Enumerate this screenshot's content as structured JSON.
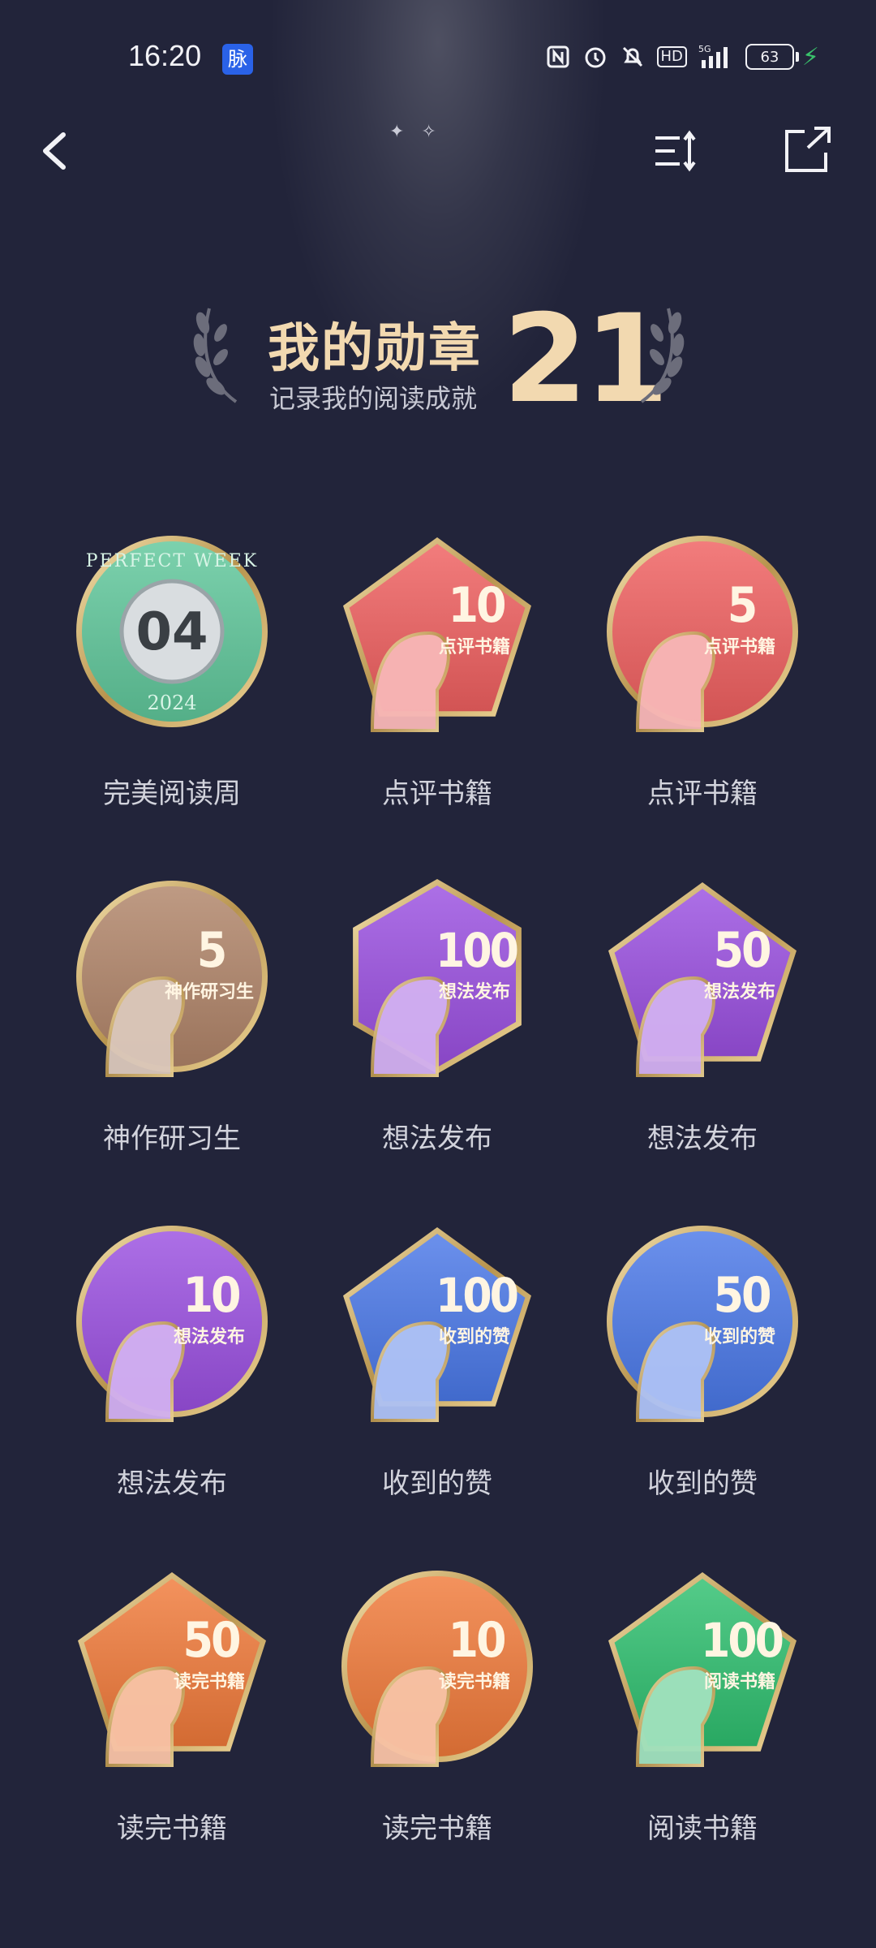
{
  "status_bar": {
    "time": "16:20",
    "app_badge": "脉",
    "network": "5G",
    "hd_label": "HD",
    "battery": "63"
  },
  "hero": {
    "title": "我的勋章",
    "subtitle": "记录我的阅读成就",
    "count": "21"
  },
  "badges": [
    {
      "label": "完美阅读周",
      "shape": "circle",
      "color": "#5fc79b",
      "line1": "04",
      "line2": "",
      "ring_text": "PERFECT WEEK",
      "year": "2024",
      "icon": "perfect-week-medal-icon"
    },
    {
      "label": "点评书籍",
      "shape": "pentagon",
      "color": "#ef5f5f",
      "line1": "10",
      "line2": "点评书籍",
      "icon": "apple-heart-icon"
    },
    {
      "label": "点评书籍",
      "shape": "circle",
      "color": "#ef5f5f",
      "line1": "5",
      "line2": "点评书籍",
      "icon": "apple-heart-icon"
    },
    {
      "label": "神作研习生",
      "shape": "circle",
      "color": "#b08468",
      "line1": "5",
      "line2": "神作研习生",
      "icon": "crown-icon"
    },
    {
      "label": "想法发布",
      "shape": "hexagon",
      "color": "#9a4fe0",
      "line1": "100",
      "line2": "想法发布",
      "icon": "head-profile-icon"
    },
    {
      "label": "想法发布",
      "shape": "pentagon",
      "color": "#9a4fe0",
      "line1": "50",
      "line2": "想法发布",
      "icon": "head-profile-icon"
    },
    {
      "label": "想法发布",
      "shape": "circle",
      "color": "#9a4fe0",
      "line1": "10",
      "line2": "想法发布",
      "icon": "head-profile-icon"
    },
    {
      "label": "收到的赞",
      "shape": "pentagon",
      "color": "#4a78e8",
      "line1": "100",
      "line2": "收到的赞",
      "icon": "thumbs-up-icon"
    },
    {
      "label": "收到的赞",
      "shape": "circle",
      "color": "#4a78e8",
      "line1": "50",
      "line2": "收到的赞",
      "icon": "thumbs-up-icon"
    },
    {
      "label": "读完书籍",
      "shape": "pentagon",
      "color": "#f07a3a",
      "line1": "50",
      "line2": "读完书籍",
      "icon": "book-stack-icon"
    },
    {
      "label": "读完书籍",
      "shape": "circle",
      "color": "#f07a3a",
      "line1": "10",
      "line2": "读完书籍",
      "icon": "book-stack-icon"
    },
    {
      "label": "阅读书籍",
      "shape": "pentagon",
      "color": "#2fbf6f",
      "line1": "100",
      "line2": "阅读书籍",
      "icon": "scroll-icon"
    }
  ]
}
